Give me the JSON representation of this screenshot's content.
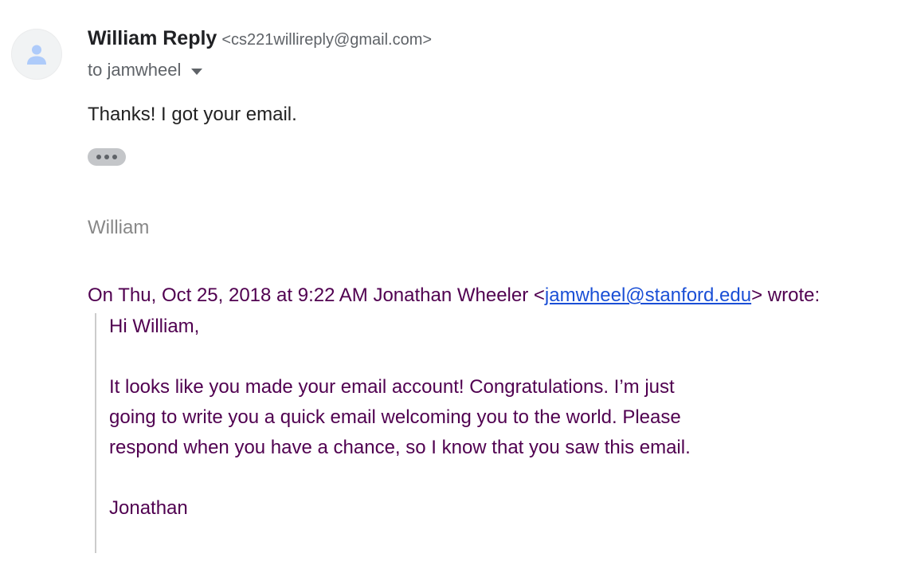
{
  "message": {
    "sender": {
      "name": "William Reply",
      "email": "<cs221willireply@gmail.com>",
      "avatar_icon": "person-icon"
    },
    "recipient": {
      "text": "to jamwheel",
      "dropdown_icon": "caret-down-icon"
    },
    "body": "Thanks! I got your email.",
    "show_trimmed_icon": "ellipsis-icon",
    "signature": "William"
  },
  "quoted": {
    "header_prefix": "On Thu, Oct 25, 2018 at 9:22 AM Jonathan Wheeler <",
    "header_link": "jamwheel@stanford.edu",
    "header_suffix": "> wrote:",
    "greeting": "Hi William,",
    "paragraph_lines": [
      "It looks like you made your email account! Congratulations. I’m just",
      "going to write you a quick email welcoming you to the world. Please",
      "respond when you have a chance, so I know that you saw this email."
    ],
    "signoff": "Jonathan"
  },
  "colors": {
    "quote_text": "#500050",
    "link": "#1a4fd6",
    "signature_text": "#888888",
    "avatar_bg": "#f1f3f4",
    "avatar_icon": "#a8c7fa"
  }
}
